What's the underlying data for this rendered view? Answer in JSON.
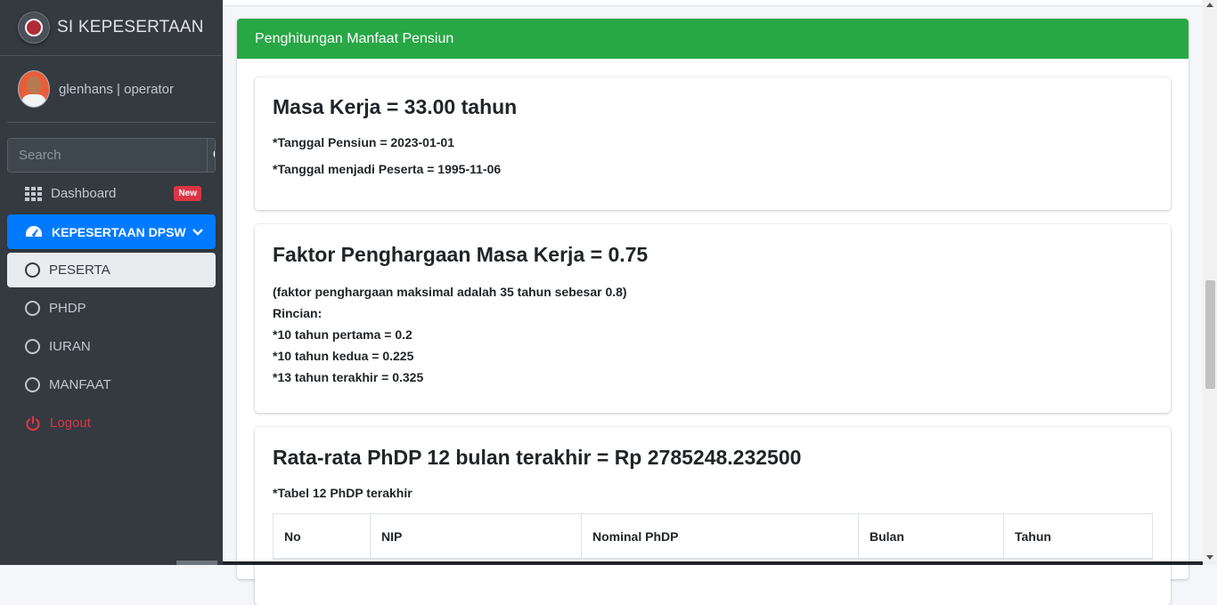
{
  "sidebar": {
    "brand": "SI KEPESERTAAN",
    "user": "glenhans | operator",
    "search_placeholder": "Search",
    "items": [
      {
        "label": "Dashboard",
        "badge": "New"
      },
      {
        "label": "KEPESERTAAN DPSW"
      },
      {
        "label": "PESERTA"
      },
      {
        "label": "PHDP"
      },
      {
        "label": "IURAN"
      },
      {
        "label": "MANFAAT"
      },
      {
        "label": "Logout"
      }
    ]
  },
  "card": {
    "header": "Penghitungan Manfaat Pensiun",
    "masa_kerja": {
      "title": "Masa Kerja = 33.00 tahun",
      "tanggal_pensiun": "*Tanggal Pensiun = 2023-01-01",
      "tanggal_peserta": "*Tanggal menjadi Peserta = 1995-11-06"
    },
    "faktor": {
      "title": "Faktor Penghargaan Masa Kerja = 0.75",
      "lines": [
        "(faktor penghargaan maksimal adalah 35 tahun sebesar 0.8)",
        "Rincian:",
        "*10 tahun pertama = 0.2",
        "*10 tahun kedua = 0.225",
        "*13 tahun terakhir = 0.325"
      ]
    },
    "phdp": {
      "title": "Rata-rata PhDP 12 bulan terakhir = Rp 2785248.232500",
      "caption": "*Tabel 12 PhDP terakhir",
      "columns": [
        "No",
        "NIP",
        "Nominal PhDP",
        "Bulan",
        "Tahun"
      ]
    }
  },
  "colors": {
    "sidebar_bg": "#343a40",
    "active": "#007bff",
    "header_green": "#28a745",
    "logout_red": "#dc3545"
  },
  "icons": {
    "search": "search-icon",
    "dashboard": "grid-icon",
    "kepesertaan": "tachometer-icon",
    "sub": "circle-icon",
    "logout": "power-icon"
  }
}
